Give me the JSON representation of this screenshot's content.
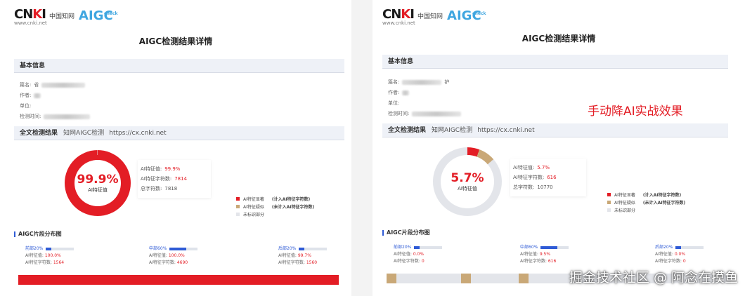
{
  "brand": {
    "cnki": "CNKI",
    "cnki_sub": "中国知网",
    "url": "www.cnki.net",
    "aigc": "AIGC",
    "aigc_sub": "check"
  },
  "colors": {
    "ai_flag": "#e31d25",
    "ai_suspect": "#c9a877",
    "unmarked": "#e3e5ea",
    "accent": "#2f5bd6"
  },
  "reports": [
    {
      "title": "AIGC检测结果详情",
      "basic_info_header": "基本信息",
      "fields": {
        "title_label": "篇名:",
        "title_value_prefix": "省",
        "author_label": "作者:",
        "unit_label": "单位:",
        "time_label": "检测时间:"
      },
      "result_header": "全文检测结果",
      "result_source": "知网AIGC检测",
      "result_url": "https://cx.cnki.net",
      "score": "99.9%",
      "score_fraction": 0.999,
      "score_label": "AI特征值",
      "stats": {
        "ai_value_label": "AI特征值:",
        "ai_value": "99.9%",
        "ai_chars_label": "AI特征字符数:",
        "ai_chars": "7814",
        "total_label": "总字符数:",
        "total": "7818"
      },
      "legend": {
        "flag": "AI特征显著",
        "flag_note": "(计入AI特征字符数)",
        "suspect": "AI特征疑似",
        "suspect_note": "(未计入AI特征字符数)",
        "unmarked": "未标识部分"
      },
      "distribution_title": "AIGC片段分布图",
      "segments": [
        {
          "label": "前部20%",
          "fill": 0.2,
          "ai_label": "AI特征值:",
          "ai_value": "100.0%",
          "chars_label": "AI特征字符数:",
          "chars": "1564"
        },
        {
          "label": "中部60%",
          "fill": 0.6,
          "ai_label": "AI特征值:",
          "ai_value": "100.0%",
          "chars_label": "AI特征字符数:",
          "chars": "4690"
        },
        {
          "label": "后部20%",
          "fill": 0.2,
          "ai_label": "AI特征值:",
          "ai_value": "99.7%",
          "chars_label": "AI特征字符数:",
          "chars": "1560"
        }
      ]
    },
    {
      "title": "AIGC检测结果详情",
      "basic_info_header": "基本信息",
      "fields": {
        "title_label": "篇名:",
        "title_value_prefix": "",
        "title_value_suffix": "护",
        "author_label": "作者:",
        "unit_label": "单位:",
        "time_label": "检测时间:"
      },
      "result_header": "全文检测结果",
      "result_source": "知网AIGC检测",
      "result_url": "https://cx.cnki.net",
      "score": "5.7%",
      "score_fraction": 0.057,
      "suspect_fraction": 0.08,
      "score_label": "AI特征值",
      "stats": {
        "ai_value_label": "AI特征值:",
        "ai_value": "5.7%",
        "ai_chars_label": "AI特征字符数:",
        "ai_chars": "616",
        "total_label": "总字符数:",
        "total": "10770"
      },
      "legend": {
        "flag": "AI特征显著",
        "flag_note": "(计入AI特征字符数)",
        "suspect": "AI特征疑似",
        "suspect_note": "(未计入AI特征字符数)",
        "unmarked": "未标识部分"
      },
      "distribution_title": "AIGC片段分布图",
      "segments": [
        {
          "label": "前部20%",
          "fill": 0.2,
          "ai_label": "AI特征值:",
          "ai_value": "0.0%",
          "chars_label": "AI特征字符数:",
          "chars": "0"
        },
        {
          "label": "中部60%",
          "fill": 0.6,
          "ai_label": "AI特征值:",
          "ai_value": "9.5%",
          "chars_label": "AI特征字符数:",
          "chars": "616"
        },
        {
          "label": "后部20%",
          "fill": 0.2,
          "ai_label": "AI特征值:",
          "ai_value": "0.0%",
          "chars_label": "AI特征字符数:",
          "chars": "0"
        }
      ],
      "overlay_text": "手动降AI实战效果"
    }
  ],
  "watermark": "掘金技术社区 @ 阿念在摸鱼"
}
